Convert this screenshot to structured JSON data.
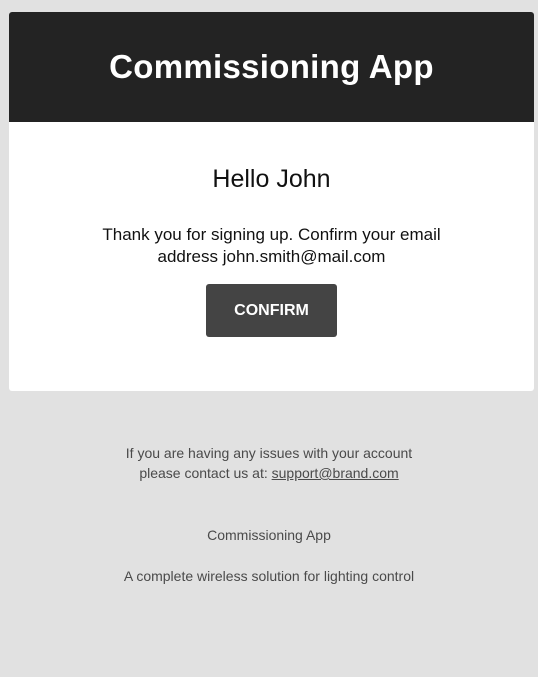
{
  "header": {
    "title": "Commissioning App"
  },
  "body": {
    "greeting": "Hello John",
    "message_line1": "Thank you for signing up. Confirm your email",
    "message_line2": "address john.smith@mail.com",
    "confirm_label": "CONFIRM"
  },
  "footer": {
    "issues_line1": "If you are having any issues with your account",
    "issues_line2_prefix": "please contact us at: ",
    "support_email": "support@brand.com",
    "app_name": "Commissioning App",
    "tagline": "A complete wireless solution for lighting control"
  },
  "colors": {
    "background": "#e1e1e1",
    "header": "#232323",
    "button": "#444444",
    "card": "#ffffff"
  }
}
